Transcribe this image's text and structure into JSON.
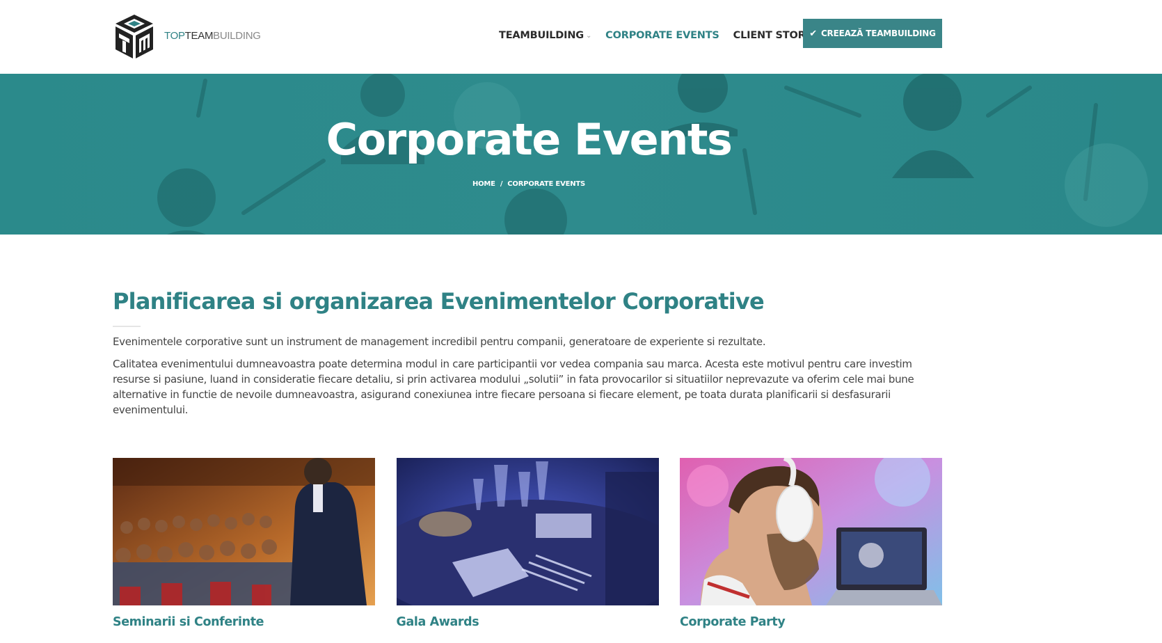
{
  "header": {
    "logo": {
      "part1": "TOP",
      "part2": "TEAM",
      "part3": "BUILDING"
    },
    "nav": [
      {
        "label": "TEAMBUILDING",
        "has_dropdown": true,
        "active": false
      },
      {
        "label": "CORPORATE EVENTS",
        "has_dropdown": false,
        "active": true
      },
      {
        "label": "CLIENT STORIES",
        "has_dropdown": false,
        "active": false
      }
    ],
    "cta_label": "CREEAZĂ TEAMBUILDING",
    "cta_icon": "check-icon"
  },
  "hero": {
    "title": "Corporate Events",
    "breadcrumb": {
      "home": "HOME",
      "separator": "/",
      "current": "CORPORATE EVENTS"
    }
  },
  "main": {
    "heading": "Planificarea si organizarea Evenimentelor Corporative",
    "paragraphs": [
      "Evenimentele corporative sunt un instrument de management incredibil pentru companii, generatoare de experiente si rezultate.",
      "Calitatea evenimentului dumneavoastra poate determina modul in care participantii vor vedea compania sau marca. Acesta este motivul pentru care investim resurse si pasiune, luand in consideratie fiecare detaliu, si prin activarea modului „solutii” in fata provocarilor si situatiilor neprevazute va oferim cele mai bune alternative in functie de nevoile dumneavoastra, asigurand conexiunea intre fiecare persoana si fiecare element, pe toata durata planificarii si desfasurarii evenimentului."
    ],
    "cards": [
      {
        "title": "Seminarii si Conferinte"
      },
      {
        "title": "Gala Awards"
      },
      {
        "title": "Corporate Party"
      }
    ]
  },
  "colors": {
    "accent": "#2f8285",
    "cta": "#3a8588",
    "hero_bg": "#2a8688",
    "text": "#444444"
  }
}
